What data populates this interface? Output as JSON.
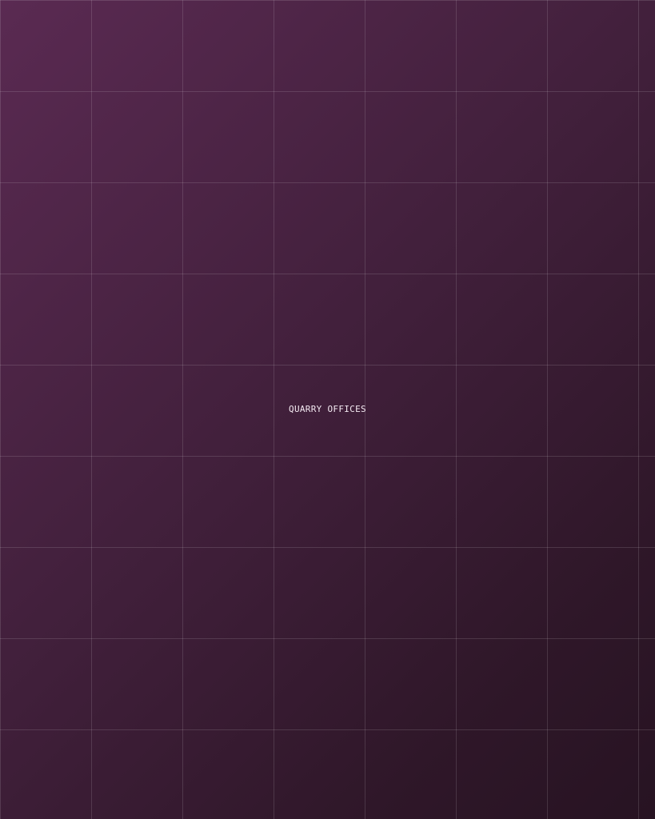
{
  "screen": {
    "label": "QUARRY OFFICES"
  },
  "colors": {
    "background_start": "#5a2a52",
    "background_end": "#271322",
    "grid_line": "rgba(255,255,255,0.13)",
    "label_text": "#f4eaf2"
  }
}
